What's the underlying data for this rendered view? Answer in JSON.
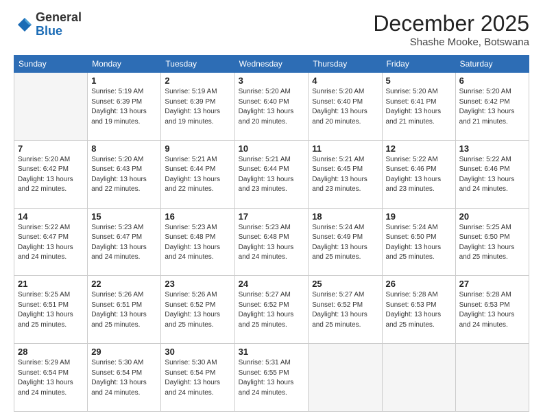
{
  "logo": {
    "general": "General",
    "blue": "Blue"
  },
  "header": {
    "month": "December 2025",
    "location": "Shashe Mooke, Botswana"
  },
  "weekdays": [
    "Sunday",
    "Monday",
    "Tuesday",
    "Wednesday",
    "Thursday",
    "Friday",
    "Saturday"
  ],
  "weeks": [
    [
      {
        "day": "",
        "info": ""
      },
      {
        "day": "1",
        "info": "Sunrise: 5:19 AM\nSunset: 6:39 PM\nDaylight: 13 hours\nand 19 minutes."
      },
      {
        "day": "2",
        "info": "Sunrise: 5:19 AM\nSunset: 6:39 PM\nDaylight: 13 hours\nand 19 minutes."
      },
      {
        "day": "3",
        "info": "Sunrise: 5:20 AM\nSunset: 6:40 PM\nDaylight: 13 hours\nand 20 minutes."
      },
      {
        "day": "4",
        "info": "Sunrise: 5:20 AM\nSunset: 6:40 PM\nDaylight: 13 hours\nand 20 minutes."
      },
      {
        "day": "5",
        "info": "Sunrise: 5:20 AM\nSunset: 6:41 PM\nDaylight: 13 hours\nand 21 minutes."
      },
      {
        "day": "6",
        "info": "Sunrise: 5:20 AM\nSunset: 6:42 PM\nDaylight: 13 hours\nand 21 minutes."
      }
    ],
    [
      {
        "day": "7",
        "info": "Sunrise: 5:20 AM\nSunset: 6:42 PM\nDaylight: 13 hours\nand 22 minutes."
      },
      {
        "day": "8",
        "info": "Sunrise: 5:20 AM\nSunset: 6:43 PM\nDaylight: 13 hours\nand 22 minutes."
      },
      {
        "day": "9",
        "info": "Sunrise: 5:21 AM\nSunset: 6:44 PM\nDaylight: 13 hours\nand 22 minutes."
      },
      {
        "day": "10",
        "info": "Sunrise: 5:21 AM\nSunset: 6:44 PM\nDaylight: 13 hours\nand 23 minutes."
      },
      {
        "day": "11",
        "info": "Sunrise: 5:21 AM\nSunset: 6:45 PM\nDaylight: 13 hours\nand 23 minutes."
      },
      {
        "day": "12",
        "info": "Sunrise: 5:22 AM\nSunset: 6:46 PM\nDaylight: 13 hours\nand 23 minutes."
      },
      {
        "day": "13",
        "info": "Sunrise: 5:22 AM\nSunset: 6:46 PM\nDaylight: 13 hours\nand 24 minutes."
      }
    ],
    [
      {
        "day": "14",
        "info": "Sunrise: 5:22 AM\nSunset: 6:47 PM\nDaylight: 13 hours\nand 24 minutes."
      },
      {
        "day": "15",
        "info": "Sunrise: 5:23 AM\nSunset: 6:47 PM\nDaylight: 13 hours\nand 24 minutes."
      },
      {
        "day": "16",
        "info": "Sunrise: 5:23 AM\nSunset: 6:48 PM\nDaylight: 13 hours\nand 24 minutes."
      },
      {
        "day": "17",
        "info": "Sunrise: 5:23 AM\nSunset: 6:48 PM\nDaylight: 13 hours\nand 24 minutes."
      },
      {
        "day": "18",
        "info": "Sunrise: 5:24 AM\nSunset: 6:49 PM\nDaylight: 13 hours\nand 25 minutes."
      },
      {
        "day": "19",
        "info": "Sunrise: 5:24 AM\nSunset: 6:50 PM\nDaylight: 13 hours\nand 25 minutes."
      },
      {
        "day": "20",
        "info": "Sunrise: 5:25 AM\nSunset: 6:50 PM\nDaylight: 13 hours\nand 25 minutes."
      }
    ],
    [
      {
        "day": "21",
        "info": "Sunrise: 5:25 AM\nSunset: 6:51 PM\nDaylight: 13 hours\nand 25 minutes."
      },
      {
        "day": "22",
        "info": "Sunrise: 5:26 AM\nSunset: 6:51 PM\nDaylight: 13 hours\nand 25 minutes."
      },
      {
        "day": "23",
        "info": "Sunrise: 5:26 AM\nSunset: 6:52 PM\nDaylight: 13 hours\nand 25 minutes."
      },
      {
        "day": "24",
        "info": "Sunrise: 5:27 AM\nSunset: 6:52 PM\nDaylight: 13 hours\nand 25 minutes."
      },
      {
        "day": "25",
        "info": "Sunrise: 5:27 AM\nSunset: 6:52 PM\nDaylight: 13 hours\nand 25 minutes."
      },
      {
        "day": "26",
        "info": "Sunrise: 5:28 AM\nSunset: 6:53 PM\nDaylight: 13 hours\nand 25 minutes."
      },
      {
        "day": "27",
        "info": "Sunrise: 5:28 AM\nSunset: 6:53 PM\nDaylight: 13 hours\nand 24 minutes."
      }
    ],
    [
      {
        "day": "28",
        "info": "Sunrise: 5:29 AM\nSunset: 6:54 PM\nDaylight: 13 hours\nand 24 minutes."
      },
      {
        "day": "29",
        "info": "Sunrise: 5:30 AM\nSunset: 6:54 PM\nDaylight: 13 hours\nand 24 minutes."
      },
      {
        "day": "30",
        "info": "Sunrise: 5:30 AM\nSunset: 6:54 PM\nDaylight: 13 hours\nand 24 minutes."
      },
      {
        "day": "31",
        "info": "Sunrise: 5:31 AM\nSunset: 6:55 PM\nDaylight: 13 hours\nand 24 minutes."
      },
      {
        "day": "",
        "info": ""
      },
      {
        "day": "",
        "info": ""
      },
      {
        "day": "",
        "info": ""
      }
    ]
  ]
}
